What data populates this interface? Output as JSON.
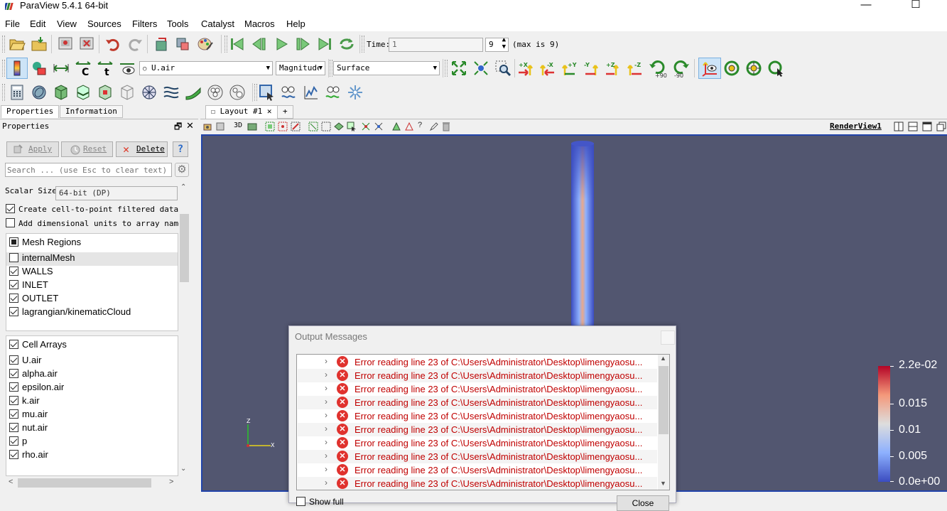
{
  "window": {
    "title": "ParaView 5.4.1 64-bit",
    "minimize": "—",
    "maximize": "☐",
    "close": "✕"
  },
  "menu": [
    "File",
    "Edit",
    "View",
    "Sources",
    "Filters",
    "Tools",
    "Catalyst",
    "Macros",
    "Help"
  ],
  "time_toolbar": {
    "time_label": "Time:",
    "time_value": "1",
    "step_value": "9",
    "max_label": "(max is 9)"
  },
  "display_toolbar": {
    "array_select": "U.air",
    "component_select": "Magnitude",
    "representation_select": "Surface",
    "camera_labels": [
      "+X",
      "-X",
      "+Y",
      "-Y",
      "+Z",
      "-Z",
      "+90",
      "-90"
    ]
  },
  "left_tabs": {
    "properties": "Properties",
    "information": "Information"
  },
  "properties_panel": {
    "title": "Properties",
    "apply": "Apply",
    "reset": "Reset",
    "delete": "Delete",
    "help": "?",
    "search_placeholder": "Search ... (use Esc to clear text)",
    "scalar_size_label": "Scalar Size",
    "scalar_size_value": "64-bit (DP)",
    "create_cell_to_point": "Create cell-to-point filtered data",
    "add_dimensional_units": "Add dimensional units to array names",
    "mesh_regions": {
      "header": "Mesh Regions",
      "items": [
        {
          "label": "internalMesh",
          "checked": false
        },
        {
          "label": "WALLS",
          "checked": true
        },
        {
          "label": "INLET",
          "checked": true
        },
        {
          "label": "OUTLET",
          "checked": true
        },
        {
          "label": "lagrangian/kinematicCloud",
          "checked": true
        }
      ]
    },
    "cell_arrays": {
      "header": "Cell Arrays",
      "items": [
        {
          "label": "U.air",
          "checked": true
        },
        {
          "label": "alpha.air",
          "checked": true
        },
        {
          "label": "epsilon.air",
          "checked": true
        },
        {
          "label": "k.air",
          "checked": true
        },
        {
          "label": "mu.air",
          "checked": true
        },
        {
          "label": "nut.air",
          "checked": true
        },
        {
          "label": "p",
          "checked": true
        },
        {
          "label": "rho.air",
          "checked": true
        }
      ]
    }
  },
  "layout": {
    "tab_label": "Layout #1",
    "add_tab": "+",
    "view_3d": "3D",
    "render_view_name": "RenderView1"
  },
  "axes": {
    "z": "Z",
    "x": "X"
  },
  "color_legend": {
    "labels": [
      "2.2e-02",
      "0.015",
      "0.01",
      "0.005",
      "0.0e+00"
    ],
    "colors": [
      "#b40426",
      "#f4987a",
      "#dddddd",
      "#8db0fe",
      "#3b4cc0"
    ]
  },
  "output_messages": {
    "title": "Output Messages",
    "messages": [
      "Error reading line 23 of C:\\Users\\Administrator\\Desktop\\limengyaosu...",
      "Error reading line 23 of C:\\Users\\Administrator\\Desktop\\limengyaosu...",
      "Error reading line 23 of C:\\Users\\Administrator\\Desktop\\limengyaosu...",
      "Error reading line 23 of C:\\Users\\Administrator\\Desktop\\limengyaosu...",
      "Error reading line 23 of C:\\Users\\Administrator\\Desktop\\limengyaosu...",
      "Error reading line 23 of C:\\Users\\Administrator\\Desktop\\limengyaosu...",
      "Error reading line 23 of C:\\Users\\Administrator\\Desktop\\limengyaosu...",
      "Error reading line 23 of C:\\Users\\Administrator\\Desktop\\limengyaosu...",
      "Error reading line 23 of C:\\Users\\Administrator\\Desktop\\limengyaosu...",
      "Error reading line 23 of C:\\Users\\Administrator\\Desktop\\limengyaosu..."
    ],
    "show_full": "Show full",
    "close": "Close"
  }
}
